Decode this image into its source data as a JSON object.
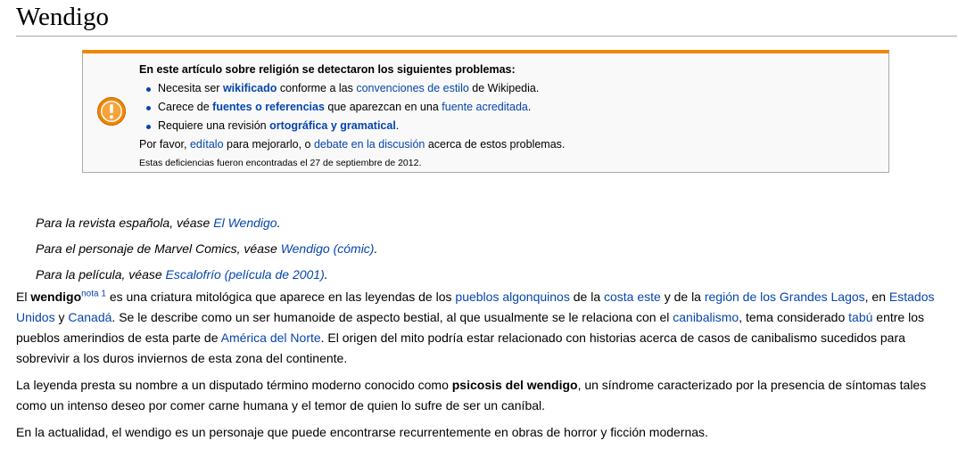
{
  "title": "Wendigo",
  "ambox": {
    "heading": "En este artículo sobre religión se detectaron los siguientes problemas:",
    "items": [
      {
        "pre": "Necesita ser ",
        "link1": "wikificado",
        "mid": " conforme a las ",
        "link2": "convenciones de estilo",
        "post": " de Wikipedia."
      },
      {
        "pre": "Carece de ",
        "link1": "fuentes o referencias",
        "mid": " que aparezcan en una ",
        "link2": "fuente acreditada",
        "post": "."
      },
      {
        "pre": "Requiere una revisión ",
        "link1": "ortográfica y gramatical",
        "post": "."
      }
    ],
    "footer": {
      "pre": "Por favor, ",
      "link1": "edítalo",
      "mid": " para mejorarlo, o ",
      "link2": "debate en la discusión",
      "post": " acerca de estos problemas."
    },
    "date_note": "Estas deficiencias fueron encontradas el 27 de septiembre de 2012."
  },
  "hatnotes": [
    {
      "pre": "Para la revista española, véase ",
      "link": "El Wendigo",
      "post": "."
    },
    {
      "pre": "Para el personaje de Marvel Comics, véase ",
      "link": "Wendigo (cómic)",
      "post": "."
    },
    {
      "pre": "Para la película, véase ",
      "link": "Escalofrío (película de 2001)",
      "post": "."
    }
  ],
  "paragraphs": {
    "p1": {
      "t0": "El ",
      "b0": "wendigo",
      "sup": "nota 1",
      "t1": " es una criatura mitológica que aparece en las leyendas de los ",
      "l1": "pueblos algonquinos",
      "t2": " de la ",
      "l2": "costa este",
      "t3": " y de la ",
      "l3": "región de los Grandes Lagos",
      "t4": ", en ",
      "l4": "Estados Unidos",
      "t5": " y ",
      "l5": "Canadá",
      "t6": ". Se le describe como un ser humanoide de aspecto bestial, al que usualmente se le relaciona con el ",
      "l6": "canibalismo",
      "t7": ", tema considerado ",
      "l7": "tabú",
      "t8": " entre los pueblos amerindios de esta parte de ",
      "l8": "América del Norte",
      "t9": ". El origen del mito podría estar relacionado con historias acerca de casos de canibalismo sucedidos para sobrevivir a los duros inviernos de esta zona del continente."
    },
    "p2": {
      "t0": "La leyenda presta su nombre a un disputado término moderno conocido como ",
      "b0": "psicosis del wendigo",
      "t1": ", un síndrome caracterizado por la presencia de síntomas tales como un intenso deseo por comer carne humana y el temor de quien lo sufre de ser un caníbal."
    },
    "p3": {
      "t0": "En la actualidad, el wendigo es un personaje que puede encontrarse recurrentemente en obras de horror y ficción modernas."
    }
  },
  "colors": {
    "link": "#0645ad",
    "ambox_border": "#f28500",
    "warning_icon": "#f28500"
  }
}
